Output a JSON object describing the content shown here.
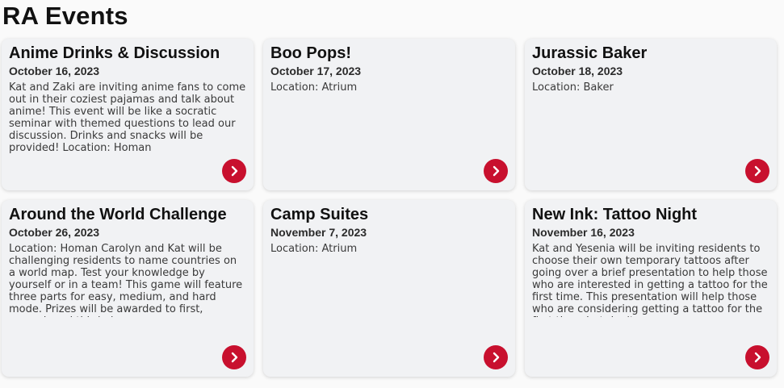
{
  "page": {
    "title": "RA Events"
  },
  "events": [
    {
      "title": "Anime Drinks & Discussion",
      "date": "October 16, 2023",
      "description": "Kat and Zaki are inviting anime fans to come out in their coziest pajamas and talk about anime! This event will be like a socratic seminar with themed questions to lead our discussion. Drinks and snacks will be provided! Location: Homan"
    },
    {
      "title": "Boo Pops!",
      "date": "October 17, 2023",
      "description": "Location: Atrium"
    },
    {
      "title": "Jurassic Baker",
      "date": "October 18, 2023",
      "description": "Location: Baker"
    },
    {
      "title": "Around the World Challenge",
      "date": "October 26, 2023",
      "description": "Location: Homan Carolyn and Kat will be challenging residents to name countries on a world map. Test your knowledge by yourself or in a team! This game will feature three parts for easy, medium, and hard mode. Prizes will be awarded to first, second, and third place."
    },
    {
      "title": "Camp Suites",
      "date": "November 7, 2023",
      "description": "Location: Atrium"
    },
    {
      "title": "New Ink: Tattoo Night",
      "date": "November 16, 2023",
      "description": "Kat and Yesenia will be inviting residents to choose their own temporary tattoos after going over a brief presentation to help those who are interested in getting a tattoo for the first time. This presentation will help those who are considering getting a tattoo for the first time, but don't..."
    }
  ],
  "icons": {
    "go": "chevron-right-icon"
  },
  "colors": {
    "accent": "#c8102e",
    "card_bg": "#f1f2f4",
    "page_bg": "#fafafa"
  }
}
